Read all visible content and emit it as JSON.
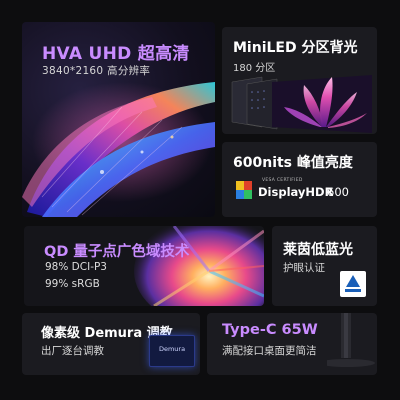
{
  "cards": {
    "hva": {
      "title": "HVA UHD 超高清",
      "subtitle": "3840*2160 高分辨率"
    },
    "miniled": {
      "title": "MiniLED 分区背光",
      "subtitle": "180 分区"
    },
    "nits": {
      "title": "600nits 峰值亮度",
      "badge_top": "VESA CERTIFIED",
      "badge_main": "DisplayHDR",
      "badge_num": "600"
    },
    "qd": {
      "title": "QD 量子点广色域技术",
      "line1": "98% DCI-P3",
      "line2": "99% sRGB"
    },
    "tuv": {
      "title": "莱茵低蓝光",
      "subtitle": "护眼认证"
    },
    "demura": {
      "title": "像素级 Demura 调教",
      "subtitle": "出厂逐台调教",
      "chip_label": "Demura"
    },
    "typec": {
      "title": "Type-C 65W",
      "subtitle": "满配接口桌面更简洁"
    }
  },
  "colors": {
    "background": "#0d0d0f",
    "card": "#1b1b20",
    "accent_purple": "#c98cff"
  }
}
